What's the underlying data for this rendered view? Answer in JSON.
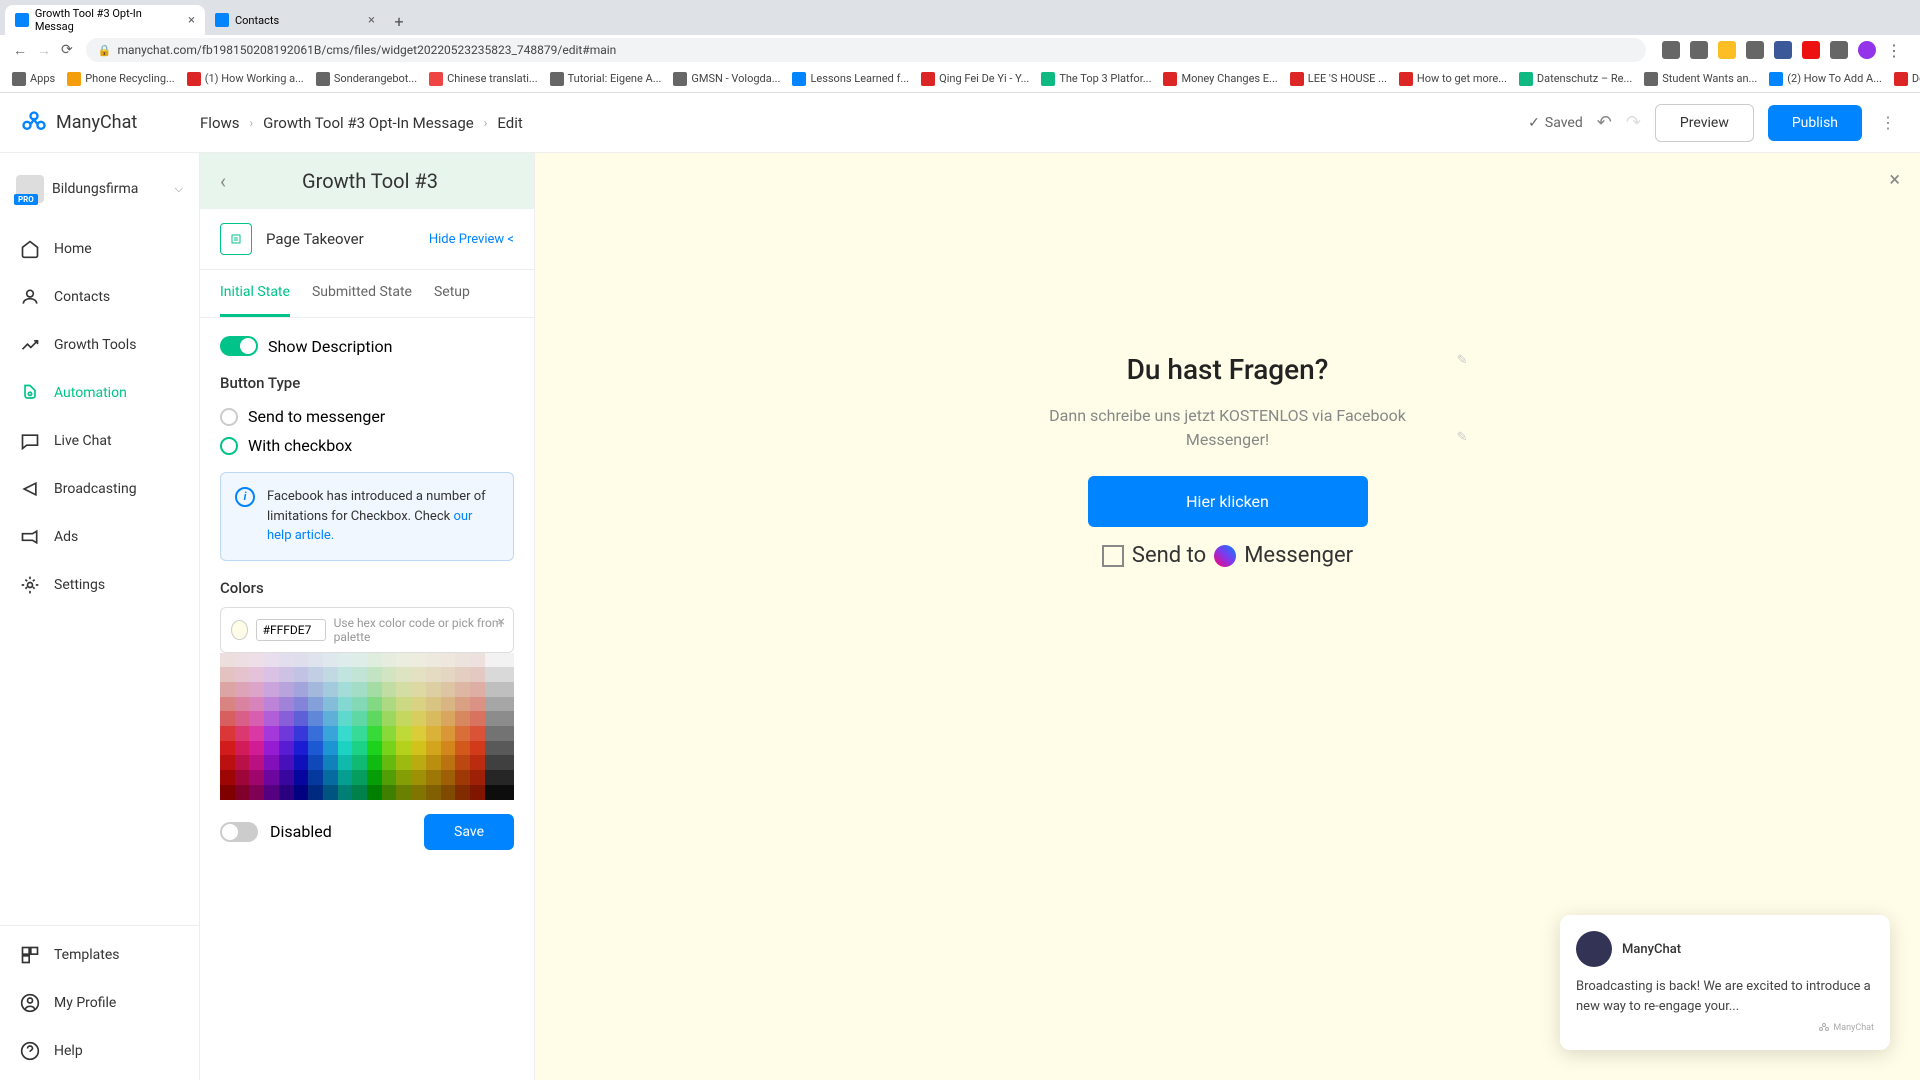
{
  "browser": {
    "tabs": [
      {
        "title": "Growth Tool #3 Opt-In Messag",
        "active": true
      },
      {
        "title": "Contacts",
        "active": false
      }
    ],
    "url": "manychat.com/fb198150208192061B/cms/files/widget20220523235823_748879/edit#main",
    "bookmarks": [
      "Apps",
      "Phone Recycling...",
      "(1) How Working a...",
      "Sonderangebot...",
      "Chinese translati...",
      "Tutorial: Eigene A...",
      "GMSN - Vologda...",
      "Lessons Learned f...",
      "Qing Fei De Yi - Y...",
      "The Top 3 Platfor...",
      "Money Changes E...",
      "LEE 'S HOUSE ...",
      "How to get more...",
      "Datenschutz – Re...",
      "Student Wants an...",
      "(2) How To Add A...",
      "Download - Cooki..."
    ]
  },
  "header": {
    "logo": "ManyChat",
    "breadcrumb": [
      "Flows",
      "Growth Tool #3 Opt-In Message",
      "Edit"
    ],
    "saved_label": "Saved",
    "preview_btn": "Preview",
    "publish_btn": "Publish"
  },
  "sidebar": {
    "org": {
      "name": "Bildungsfirma",
      "badge": "PRO"
    },
    "items": [
      {
        "key": "home",
        "label": "Home"
      },
      {
        "key": "contacts",
        "label": "Contacts"
      },
      {
        "key": "growth-tools",
        "label": "Growth Tools"
      },
      {
        "key": "automation",
        "label": "Automation",
        "active": true
      },
      {
        "key": "live-chat",
        "label": "Live Chat"
      },
      {
        "key": "broadcasting",
        "label": "Broadcasting"
      },
      {
        "key": "ads",
        "label": "Ads"
      },
      {
        "key": "settings",
        "label": "Settings"
      }
    ],
    "bottom": [
      {
        "key": "templates",
        "label": "Templates"
      },
      {
        "key": "my-profile",
        "label": "My Profile"
      },
      {
        "key": "help",
        "label": "Help"
      }
    ]
  },
  "editor": {
    "title": "Growth Tool #3",
    "widget_type": "Page Takeover",
    "hide_preview": "Hide Preview <",
    "tabs": [
      "Initial State",
      "Submitted State",
      "Setup"
    ],
    "active_tab": 0,
    "show_description_label": "Show Description",
    "button_type_label": "Button Type",
    "radio_send": "Send to messenger",
    "radio_checkbox": "With checkbox",
    "info_text": "Facebook has introduced a number of limitations for Checkbox. Check ",
    "info_link": "our help article.",
    "colors_label": "Colors",
    "hex": "#FFFDE7",
    "color_hint": "Use hex color code or pick from palette",
    "disabled_label": "Disabled",
    "save_btn": "Save"
  },
  "preview": {
    "heading": "Du hast Fragen?",
    "description": "Dann schreibe uns jetzt KOSTENLOS via Facebook Messenger!",
    "button": "Hier klicken",
    "send_to": "Send to",
    "messenger": "Messenger"
  },
  "chat": {
    "name": "ManyChat",
    "body": "Broadcasting is back! We are excited to introduce a new way to re-engage your...",
    "brand": "ManyChat"
  }
}
